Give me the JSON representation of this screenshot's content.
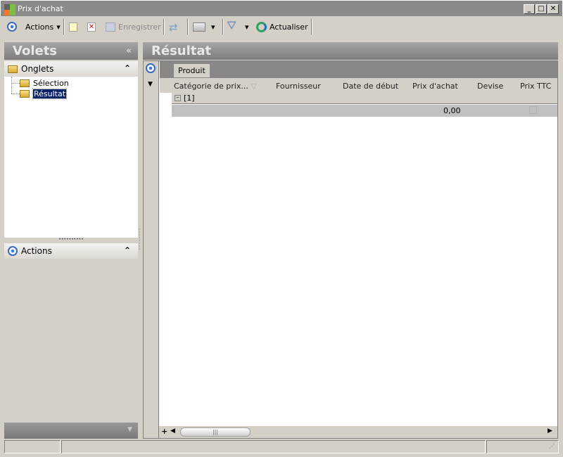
{
  "window": {
    "title": "Prix d'achat",
    "min": "_",
    "max": "□",
    "close": "✕"
  },
  "toolbar": {
    "actions": "Actions",
    "save": "Enregistrer",
    "refresh": "Actualiser"
  },
  "left": {
    "title": "Volets",
    "collapse": "«",
    "tabs_section": "Onglets",
    "tree": [
      {
        "label": "Sélection"
      },
      {
        "label": "Résultat"
      }
    ],
    "actions_section": "Actions",
    "expand": "⌃"
  },
  "main": {
    "title": "Résultat",
    "group_button": "Produit",
    "columns": [
      "Catégorie de prix...",
      "Fournisseur",
      "Date de début",
      "Prix d'achat",
      "Devise",
      "Prix TTC"
    ],
    "group_label": "[1]",
    "summary_value": "0,00",
    "add": "+"
  }
}
